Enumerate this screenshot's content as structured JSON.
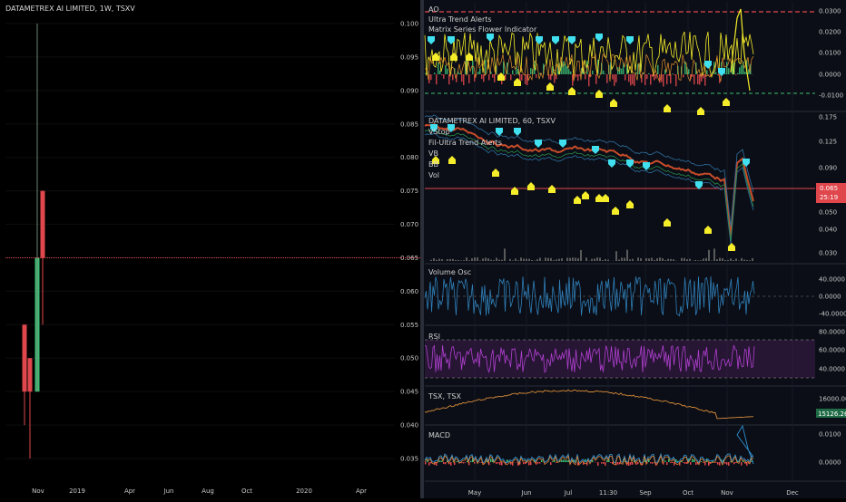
{
  "colors": {
    "background": "#000000",
    "right_panel_bg": "#0b0e16",
    "grid": "#1c2030",
    "text": "#c8c8c8",
    "up": "#3dbd73",
    "down": "#e0474c",
    "priceline": "#e0474c",
    "cyan": "#40e0f0",
    "yellow": "#f5ec2a",
    "purple": "#9b30b8",
    "vol_osc": "#2f7fb8",
    "tsx_line": "#d98c3a"
  },
  "left_chart": {
    "title": "DATAMETREX AI LIMITED, 1W, TSXV",
    "y_ticks": [
      "0.100",
      "0.095",
      "0.090",
      "0.085",
      "0.080",
      "0.075",
      "0.070",
      "0.065",
      "0.060",
      "0.055",
      "0.050",
      "0.045",
      "0.040",
      "0.035"
    ],
    "x_ticks": [
      "Nov",
      "2019",
      "Apr",
      "Jun",
      "Aug",
      "Oct",
      "2020",
      "Apr"
    ],
    "price_line": "0.065"
  },
  "chart_data": [
    {
      "type": "candlestick",
      "title": "DATAMETREX AI LIMITED, 1W, TSXV",
      "ylim": [
        0.033,
        0.103
      ],
      "x_labels": [
        "Nov",
        "2019",
        "Apr",
        "Jun",
        "Aug",
        "Oct",
        "2020",
        "Apr"
      ],
      "candles": [
        {
          "open": 0.055,
          "high": 0.055,
          "low": 0.04,
          "close": 0.045
        },
        {
          "open": 0.05,
          "high": 0.05,
          "low": 0.035,
          "close": 0.045
        },
        {
          "open": 0.045,
          "high": 0.1,
          "low": 0.045,
          "close": 0.065
        },
        {
          "open": 0.075,
          "high": 0.075,
          "low": 0.055,
          "close": 0.065
        }
      ],
      "last_price": 0.065
    }
  ],
  "right_chart": {
    "ao_panel": {
      "legend": [
        "AO",
        "Ultra Trend Alerts",
        "Matrix Series Flower Indicator"
      ],
      "y_ticks": [
        "0.0300",
        "0.0200",
        "0.0100",
        "0.0000",
        "-0.0100"
      ]
    },
    "main_panel": {
      "title": "DATAMETREX AI LIMITED, 60, TSXV",
      "legend": [
        "VStop",
        "Fil-Ultra Trend Alerts",
        "VB",
        "BB",
        "Vol"
      ],
      "y_ticks": [
        "0.175",
        "0.125",
        "0.090",
        "0.065",
        "0.050",
        "0.040",
        "0.030"
      ],
      "price_badge": "0.065",
      "time_badge": "25:19"
    },
    "vol_osc_panel": {
      "legend": "Volume Osc",
      "y_ticks": [
        "40.0000",
        "0.0000",
        "-40.0000"
      ]
    },
    "rsi_panel": {
      "legend": "RSI",
      "y_ticks": [
        "80.0000",
        "60.0000",
        "40.0000"
      ]
    },
    "tsx_panel": {
      "legend": "TSX, TSX",
      "y_ticks": [
        "16000.00"
      ],
      "price_badge": "15126.26"
    },
    "macd_panel": {
      "legend": "MACD",
      "y_ticks": [
        "0.0100",
        "0.0000"
      ]
    },
    "x_ticks": [
      "May",
      "Jun",
      "Jul",
      "11:30",
      "Sep",
      "Oct",
      "Nov",
      "Dec"
    ]
  }
}
